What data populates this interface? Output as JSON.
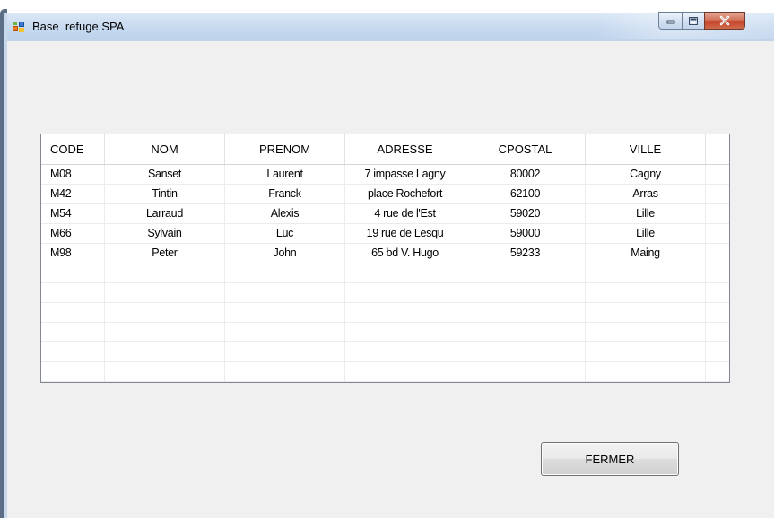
{
  "window": {
    "title": "Base  refuge SPA",
    "controls": {
      "minimize_icon": "minimize-icon",
      "maximize_icon": "maximize-icon",
      "close_icon": "close-icon"
    },
    "colors": {
      "titlebar": "#c8daf0",
      "client": "#f0f0f0",
      "close": "#c4432a"
    }
  },
  "grid": {
    "columns": [
      "CODE",
      "NOM",
      "PRENOM",
      "ADRESSE",
      "CPOSTAL",
      "VILLE"
    ],
    "rows": [
      [
        "M08",
        "Sanset",
        "Laurent",
        "7 impasse Lagny",
        "80002",
        "Cagny"
      ],
      [
        "M42",
        "Tintin",
        "Franck",
        "place Rochefort",
        "62100",
        "Arras"
      ],
      [
        "M54",
        "Larraud",
        "Alexis",
        "4 rue de l'Est",
        "59020",
        "Lille"
      ],
      [
        "M66",
        "Sylvain",
        "Luc",
        "19 rue de Lesqu",
        "59000",
        "Lille"
      ],
      [
        "M98",
        "Peter",
        "John",
        "65 bd V. Hugo",
        "59233",
        "Maing"
      ]
    ]
  },
  "buttons": {
    "close_label": "FERMER"
  }
}
